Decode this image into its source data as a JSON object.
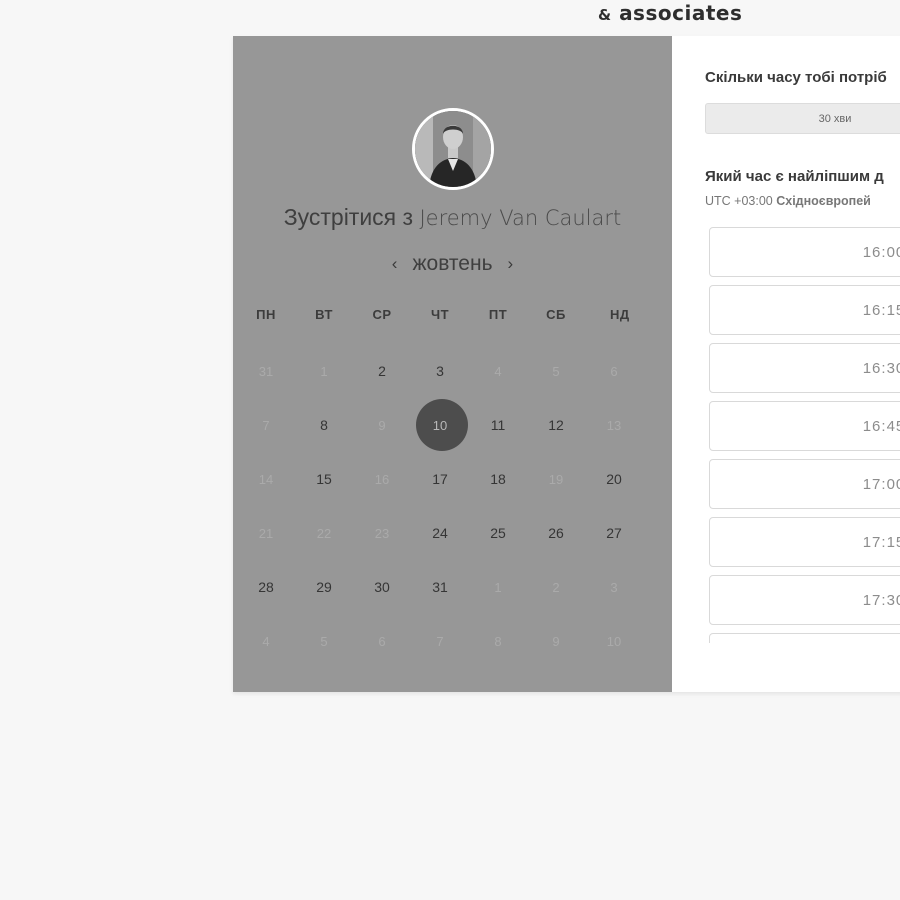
{
  "brand": {
    "amp": "&",
    "text": "associates"
  },
  "calendar": {
    "heading_prefix": "Зустрітися з",
    "heading_name": "Jeremy Van Caulart",
    "month": "жовтень",
    "prev_icon": "‹",
    "next_icon": "›",
    "weekdays": [
      "ПН",
      "ВТ",
      "СР",
      "ЧТ",
      "ПТ",
      "СБ",
      "НД"
    ],
    "weeks": [
      [
        {
          "d": "31",
          "s": "off"
        },
        {
          "d": "1",
          "s": "off"
        },
        {
          "d": "2",
          "s": "avail"
        },
        {
          "d": "3",
          "s": "avail"
        },
        {
          "d": "4",
          "s": "off"
        },
        {
          "d": "5",
          "s": "off"
        },
        {
          "d": "6",
          "s": "off"
        }
      ],
      [
        {
          "d": "7",
          "s": "off"
        },
        {
          "d": "8",
          "s": "avail"
        },
        {
          "d": "9",
          "s": "off"
        },
        {
          "d": "10",
          "s": "selected"
        },
        {
          "d": "11",
          "s": "avail"
        },
        {
          "d": "12",
          "s": "avail"
        },
        {
          "d": "13",
          "s": "off"
        }
      ],
      [
        {
          "d": "14",
          "s": "off"
        },
        {
          "d": "15",
          "s": "avail"
        },
        {
          "d": "16",
          "s": "off"
        },
        {
          "d": "17",
          "s": "avail"
        },
        {
          "d": "18",
          "s": "avail"
        },
        {
          "d": "19",
          "s": "off"
        },
        {
          "d": "20",
          "s": "avail"
        }
      ],
      [
        {
          "d": "21",
          "s": "off"
        },
        {
          "d": "22",
          "s": "off"
        },
        {
          "d": "23",
          "s": "off"
        },
        {
          "d": "24",
          "s": "avail"
        },
        {
          "d": "25",
          "s": "avail"
        },
        {
          "d": "26",
          "s": "avail"
        },
        {
          "d": "27",
          "s": "avail"
        }
      ],
      [
        {
          "d": "28",
          "s": "avail"
        },
        {
          "d": "29",
          "s": "avail"
        },
        {
          "d": "30",
          "s": "avail"
        },
        {
          "d": "31",
          "s": "avail"
        },
        {
          "d": "1",
          "s": "off"
        },
        {
          "d": "2",
          "s": "off"
        },
        {
          "d": "3",
          "s": "off"
        }
      ],
      [
        {
          "d": "4",
          "s": "off"
        },
        {
          "d": "5",
          "s": "off"
        },
        {
          "d": "6",
          "s": "off"
        },
        {
          "d": "7",
          "s": "off"
        },
        {
          "d": "8",
          "s": "off"
        },
        {
          "d": "9",
          "s": "off"
        },
        {
          "d": "10",
          "s": "off"
        }
      ]
    ]
  },
  "booking": {
    "duration_question": "Скільки часу тобі потріб",
    "duration_value": "30 хви",
    "time_question": "Який час є найліпшим д",
    "tz_offset": "UTC +03:00",
    "tz_name": "Східноєвропей",
    "slots": [
      "16:00",
      "16:15",
      "16:30",
      "16:45",
      "17:00",
      "17:15",
      "17:30",
      ""
    ]
  },
  "colors": {
    "left_panel": "#979797",
    "selected_day": "#4d4d4d",
    "page_bg": "#f7f7f7"
  }
}
